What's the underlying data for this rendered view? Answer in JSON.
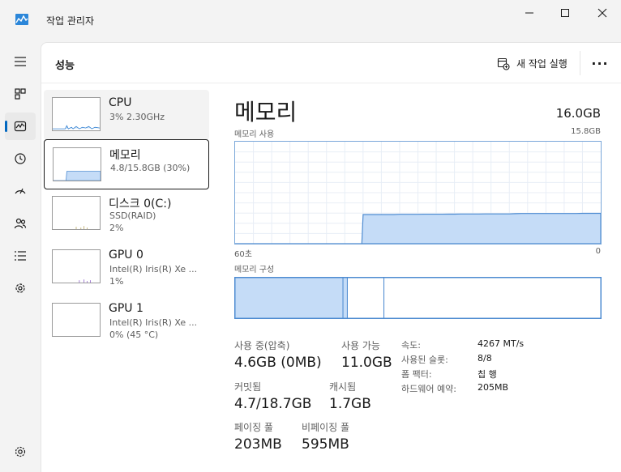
{
  "window": {
    "title": "작업 관리자"
  },
  "icons": {
    "app": "task-manager-icon",
    "nav": [
      "hamburger-menu-icon",
      "processes-icon",
      "performance-icon",
      "app-history-icon",
      "startup-apps-icon",
      "users-icon",
      "details-icon",
      "services-icon",
      "settings-icon"
    ]
  },
  "colors": {
    "accent": "#0067c0",
    "memory_fill": "#c5dcf7",
    "memory_line": "#4d8bd1"
  },
  "header": {
    "title": "성능",
    "run_task": "새 작업 실행",
    "more": "···"
  },
  "devices": [
    {
      "name": "CPU",
      "sub1": "3% 2.30GHz",
      "sub2": ""
    },
    {
      "name": "메모리",
      "sub1": "4.8/15.8GB (30%)",
      "sub2": ""
    },
    {
      "name": "디스크 0(C:)",
      "sub1": "SSD(RAID)",
      "sub2": "2%"
    },
    {
      "name": "GPU 0",
      "sub1": "Intel(R) Iris(R) Xe ...",
      "sub2": "1%"
    },
    {
      "name": "GPU 1",
      "sub1": "Intel(R) Iris(R) Xe ...",
      "sub2": "0% (45 °C)"
    }
  ],
  "detail": {
    "title": "메모리",
    "total": "16.0GB",
    "usage_label": "메모리 사용",
    "usage_max": "15.8GB",
    "axis_left": "60초",
    "axis_right": "0",
    "composition_label": "메모리 구성",
    "composition": {
      "in_use": 0.295,
      "modified": 0.012,
      "standby": 0.1,
      "free": 0.593
    },
    "usage_series": [
      0,
      0,
      0,
      0,
      0,
      0,
      0,
      0,
      0,
      0,
      0,
      0,
      0,
      0,
      0,
      0,
      0,
      0,
      0,
      0,
      0,
      4.52,
      4.52,
      4.52,
      4.52,
      4.52,
      4.52,
      4.55,
      4.55,
      4.55,
      4.55,
      4.57,
      4.57,
      4.57,
      4.57,
      4.58,
      4.58,
      4.6,
      4.6,
      4.6,
      4.6,
      4.62,
      4.62,
      4.62,
      4.62,
      4.62,
      4.65,
      4.68,
      4.68,
      4.68,
      4.68,
      4.68,
      4.68,
      4.68,
      4.68,
      4.68,
      4.68,
      4.7,
      4.7,
      4.7,
      4.7
    ]
  },
  "stats": {
    "in_use_label": "사용 중(압축)",
    "in_use_value": "4.6GB (0MB)",
    "available_label": "사용 가능",
    "available_value": "11.0GB",
    "committed_label": "커밋됨",
    "committed_value": "4.7/18.7GB",
    "cached_label": "캐시됨",
    "cached_value": "1.7GB",
    "paged_label": "페이징 풀",
    "paged_value": "203MB",
    "nonpaged_label": "비페이징 풀",
    "nonpaged_value": "595MB"
  },
  "specs": [
    {
      "key": "속도:",
      "value": "4267 MT/s"
    },
    {
      "key": "사용된 슬롯:",
      "value": "8/8"
    },
    {
      "key": "폼 팩터:",
      "value": "칩 행"
    },
    {
      "key": "하드웨어 예약:",
      "value": "205MB"
    }
  ]
}
